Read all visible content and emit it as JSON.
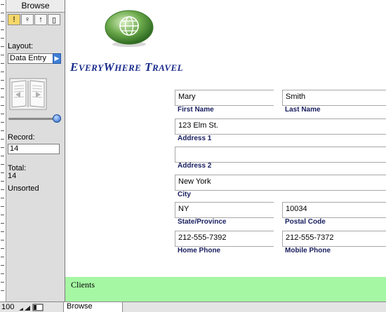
{
  "status_area": {
    "mode_title": "Browse",
    "tools": [
      {
        "icon": "browse-tool-icon",
        "glyph": "!"
      },
      {
        "icon": "find-tool-icon",
        "glyph": "♀"
      },
      {
        "icon": "sort-tool-icon",
        "glyph": "↑"
      },
      {
        "icon": "preview-tool-icon",
        "glyph": "▯"
      }
    ],
    "layout_label": "Layout:",
    "layout_value": "Data Entry",
    "record_label": "Record:",
    "record_value": "14",
    "total_label": "Total:",
    "total_value": "14",
    "sort_status": "Unsorted"
  },
  "brand": {
    "name_big1": "E",
    "name_small1": "VERY",
    "name_big2": "W",
    "name_small2": "HERE",
    "name_big3": " T",
    "name_small3": "RAVEL"
  },
  "record": {
    "first_name": {
      "value": "Mary",
      "label": "First Name"
    },
    "last_name": {
      "value": "Smith",
      "label": "Last Name"
    },
    "address1": {
      "value": "123 Elm St.",
      "label": "Address 1"
    },
    "address2": {
      "value": "",
      "label": "Address 2"
    },
    "city": {
      "value": "New York",
      "label": "City"
    },
    "state": {
      "value": "NY",
      "label": "State/Province"
    },
    "postal": {
      "value": "10034",
      "label": "Postal Code"
    },
    "home_phone": {
      "value": "212-555-7392",
      "label": "Home Phone"
    },
    "mobile_phone": {
      "value": "212-555-7372",
      "label": "Mobile Phone"
    }
  },
  "footer": {
    "text": "Clients"
  },
  "bottom_bar": {
    "zoom": "100",
    "mode": "Browse"
  },
  "colors": {
    "footer_band": "#a6f7a4",
    "brand": "#1a2c8c",
    "field_label": "#1a2060"
  }
}
